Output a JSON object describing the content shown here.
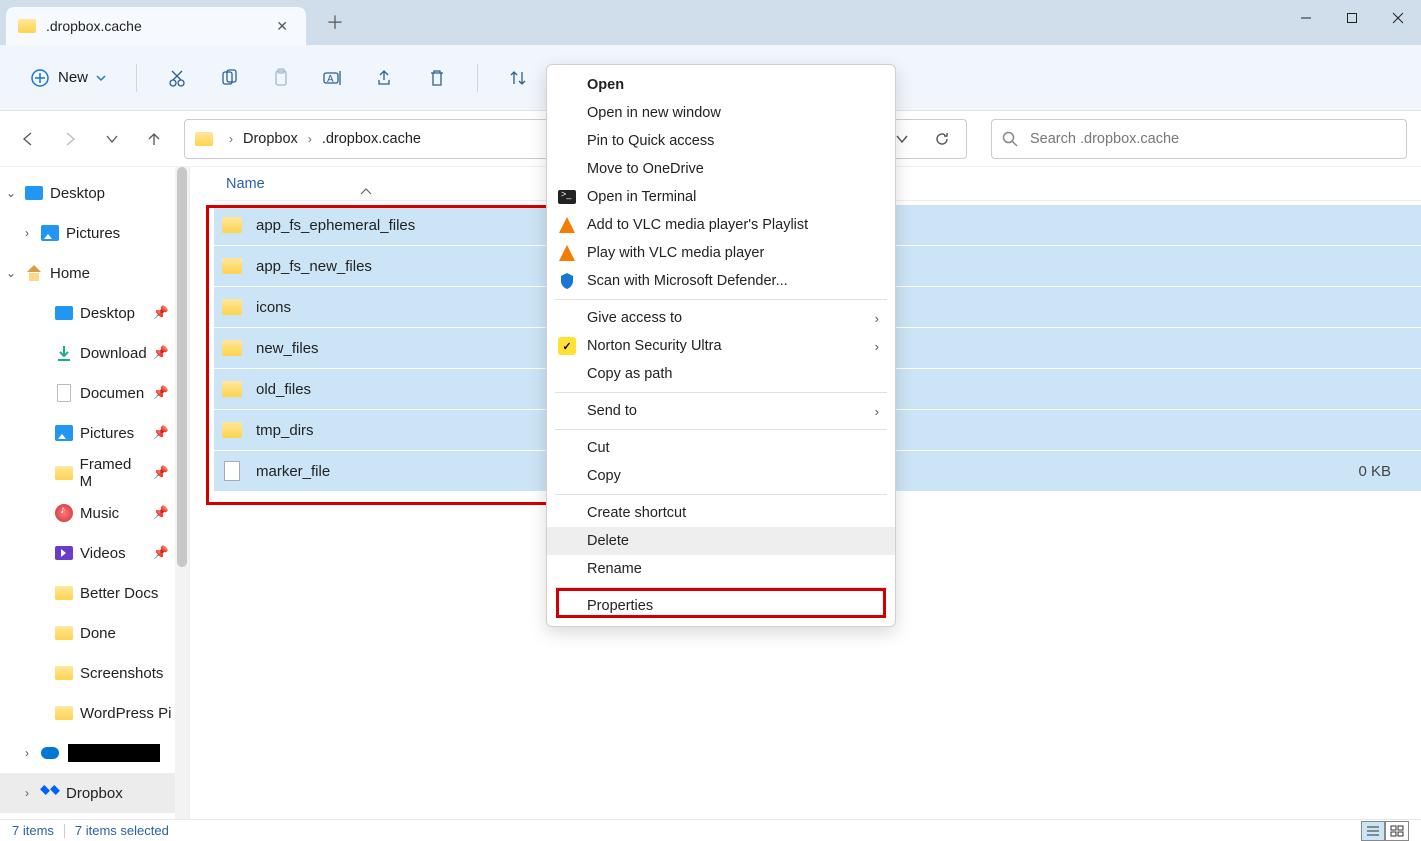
{
  "window": {
    "title": ".dropbox.cache"
  },
  "toolbar": {
    "new_label": "New"
  },
  "breadcrumb": {
    "seg1": "Dropbox",
    "seg2": ".dropbox.cache"
  },
  "search": {
    "placeholder": "Search .dropbox.cache"
  },
  "sidebar": {
    "desktop": "Desktop",
    "pictures": "Pictures",
    "home": "Home",
    "desktop2": "Desktop",
    "downloads": "Download",
    "documents": "Documen",
    "pictures2": "Pictures",
    "framed": "Framed M",
    "music": "Music",
    "videos": "Videos",
    "betterdocs": "Better Docs",
    "done": "Done",
    "screenshots": "Screenshots",
    "wordpress": "WordPress Pi",
    "dropbox": "Dropbox"
  },
  "columns": {
    "name": "Name"
  },
  "files": [
    {
      "name": "app_fs_ephemeral_files",
      "type": "folder",
      "size": ""
    },
    {
      "name": "app_fs_new_files",
      "type": "folder",
      "size": ""
    },
    {
      "name": "icons",
      "type": "folder",
      "size": ""
    },
    {
      "name": "new_files",
      "type": "folder",
      "size": ""
    },
    {
      "name": "old_files",
      "type": "folder",
      "size": ""
    },
    {
      "name": "tmp_dirs",
      "type": "folder",
      "size": ""
    },
    {
      "name": "marker_file",
      "type": "file",
      "size": "0 KB"
    }
  ],
  "context_menu": {
    "open": "Open",
    "open_new_window": "Open in new window",
    "pin_quick": "Pin to Quick access",
    "move_onedrive": "Move to OneDrive",
    "open_terminal": "Open in Terminal",
    "add_vlc": "Add to VLC media player's Playlist",
    "play_vlc": "Play with VLC media player",
    "scan_defender": "Scan with Microsoft Defender...",
    "give_access": "Give access to",
    "norton": "Norton Security Ultra",
    "copy_path": "Copy as path",
    "send_to": "Send to",
    "cut": "Cut",
    "copy": "Copy",
    "create_shortcut": "Create shortcut",
    "delete": "Delete",
    "rename": "Rename",
    "properties": "Properties"
  },
  "status": {
    "count": "7 items",
    "selected": "7 items selected"
  }
}
